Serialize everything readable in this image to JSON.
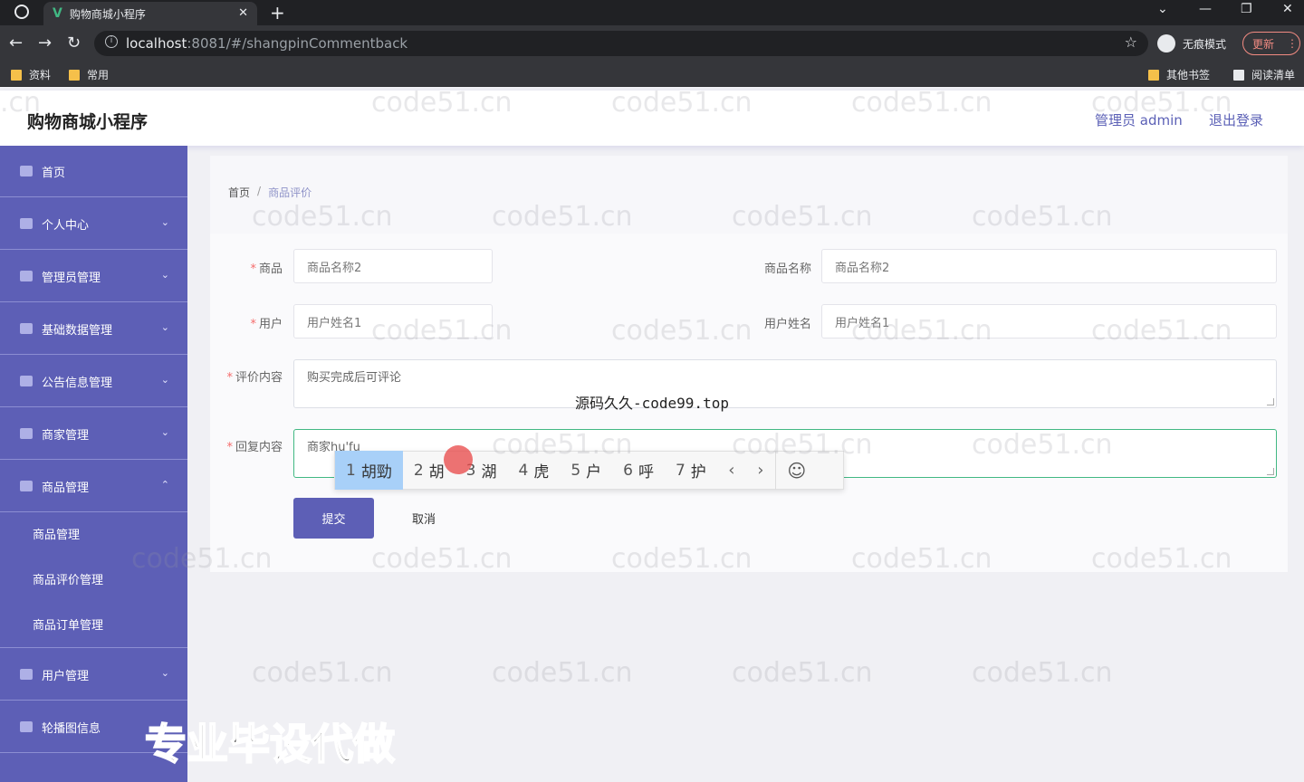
{
  "browser": {
    "tab_title": "购物商城小程序",
    "tab_close": "✕",
    "new_tab": "+",
    "url_host": "localhost",
    "url_rest": ":8081/#/shangpinCommentback",
    "incognito": "无痕模式",
    "update": "更新",
    "bookmarks": [
      "资料",
      "常用"
    ],
    "bookmarks_right": [
      "其他书签",
      "阅读清单"
    ]
  },
  "header": {
    "title": "购物商城小程序",
    "admin": "管理员 admin",
    "logout": "退出登录"
  },
  "sidebar": {
    "items": [
      {
        "label": "首页"
      },
      {
        "label": "个人中心"
      },
      {
        "label": "管理员管理"
      },
      {
        "label": "基础数据管理"
      },
      {
        "label": "公告信息管理"
      },
      {
        "label": "商家管理"
      },
      {
        "label": "商品管理"
      },
      {
        "label": "用户管理"
      },
      {
        "label": "轮播图信息"
      }
    ],
    "submenu": [
      "商品管理",
      "商品评价管理",
      "商品订单管理"
    ]
  },
  "breadcrumb": {
    "home": "首页",
    "sep": "/",
    "current": "商品评价"
  },
  "form": {
    "goods_label": "商品",
    "goods_value": "商品名称2",
    "goods_name_label": "商品名称",
    "goods_name_value": "商品名称2",
    "user_label": "用户",
    "user_value": "用户姓名1",
    "user_name_label": "用户姓名",
    "user_name_value": "用户姓名1",
    "comment_label": "评价内容",
    "comment_value": "购买完成后可评论",
    "reply_label": "回复内容",
    "reply_value": "商家hu'fu",
    "required_mark": "*",
    "submit": "提交",
    "cancel": "取消"
  },
  "ime": {
    "candidates": [
      {
        "num": "1",
        "text": "胡勁"
      },
      {
        "num": "2",
        "text": "胡"
      },
      {
        "num": "3",
        "text": "湖"
      },
      {
        "num": "4",
        "text": "虎"
      },
      {
        "num": "5",
        "text": "户"
      },
      {
        "num": "6",
        "text": "呼"
      },
      {
        "num": "7",
        "text": "护"
      }
    ],
    "prev": "‹",
    "next": "›",
    "emoji": "☺"
  },
  "watermark": "code51.cn",
  "overlay_center": "源码久久-code99.top",
  "overlay_big": "专业毕设代做"
}
